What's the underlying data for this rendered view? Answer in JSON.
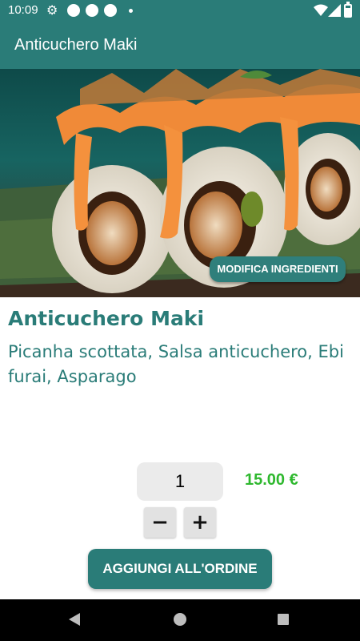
{
  "status_bar": {
    "time": "10:09"
  },
  "app_bar": {
    "title": "Anticuchero Maki"
  },
  "hero": {
    "edit_ingredients_label": "MODIFICA INGREDIENTI"
  },
  "product": {
    "name": "Anticuchero Maki",
    "description": "Picanha scottata, Salsa anticuchero, Ebi furai, Asparago",
    "quantity": "1",
    "price": "15.00 €",
    "decrease_label": "−",
    "increase_label": "+",
    "add_to_order_label": "AGGIUNGI ALL'ORDINE"
  },
  "colors": {
    "primary": "#2a7c78",
    "price": "#2eb82e",
    "qty_background": "#ebebeb"
  }
}
